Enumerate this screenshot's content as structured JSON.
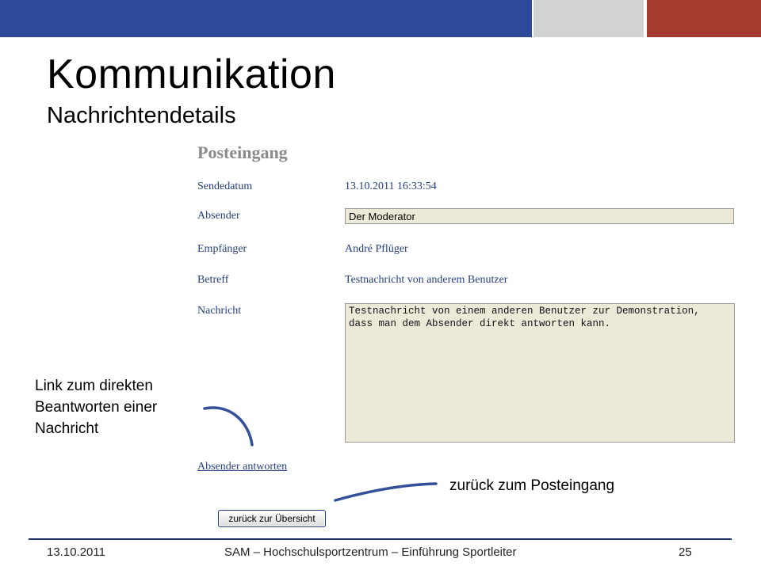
{
  "slide": {
    "title": "Kommunikation",
    "subtitle": "Nachrichtendetails",
    "colors": {
      "blue": "#2e4a9a",
      "gray": "#d0d3d1",
      "red": "#a43b2e",
      "link": "#26407e"
    }
  },
  "message": {
    "heading": "Posteingang",
    "fields": {
      "sendedatum_label": "Sendedatum",
      "sendedatum_value": "13.10.2011 16:33:54",
      "absender_label": "Absender",
      "absender_value": "Der Moderator",
      "empfaenger_label": "Empfänger",
      "empfaenger_value": "André Pflüger",
      "betreff_label": "Betreff",
      "betreff_value": "Testnachricht von anderem Benutzer",
      "nachricht_label": "Nachricht",
      "nachricht_value": "Testnachricht von einem anderen Benutzer zur Demonstration,\ndass man dem Absender direkt antworten kann."
    },
    "reply_link": "Absender antworten",
    "back_button": "zurück zur Übersicht"
  },
  "annotations": {
    "reply_note": "Link zum direkten Beantworten einer Nachricht",
    "back_note": "zurück zum Posteingang"
  },
  "footer": {
    "date": "13.10.2011",
    "center": "SAM – Hochschulsportzentrum – Einführung Sportleiter",
    "page": "25"
  }
}
